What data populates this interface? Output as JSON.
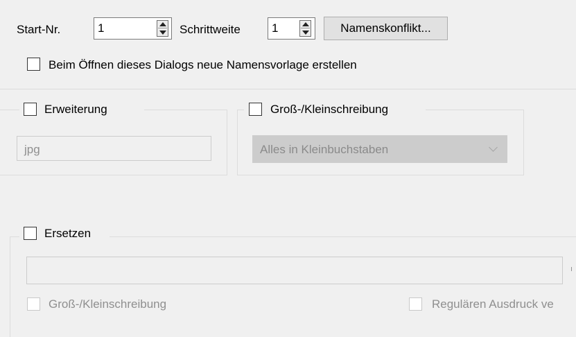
{
  "numbering": {
    "start_label": "Start-Nr.",
    "start_value": "1",
    "step_label": "Schrittweite",
    "step_value": "1",
    "conflict_button": "Namenskonflikt..."
  },
  "template_checkbox": {
    "label": "Beim Öffnen dieses Dialogs neue Namensvorlage erstellen",
    "checked": false
  },
  "extension": {
    "label": "Erweiterung",
    "checked": false,
    "value": "jpg"
  },
  "case": {
    "label": "Groß-/Kleinschreibung",
    "checked": false,
    "selected": "Alles in Kleinbuchstaben"
  },
  "replace": {
    "label": "Ersetzen",
    "checked": false,
    "value": "",
    "case_option_label": "Groß-/Kleinschreibung",
    "regex_option_label": "Regulären Ausdruck ve"
  }
}
